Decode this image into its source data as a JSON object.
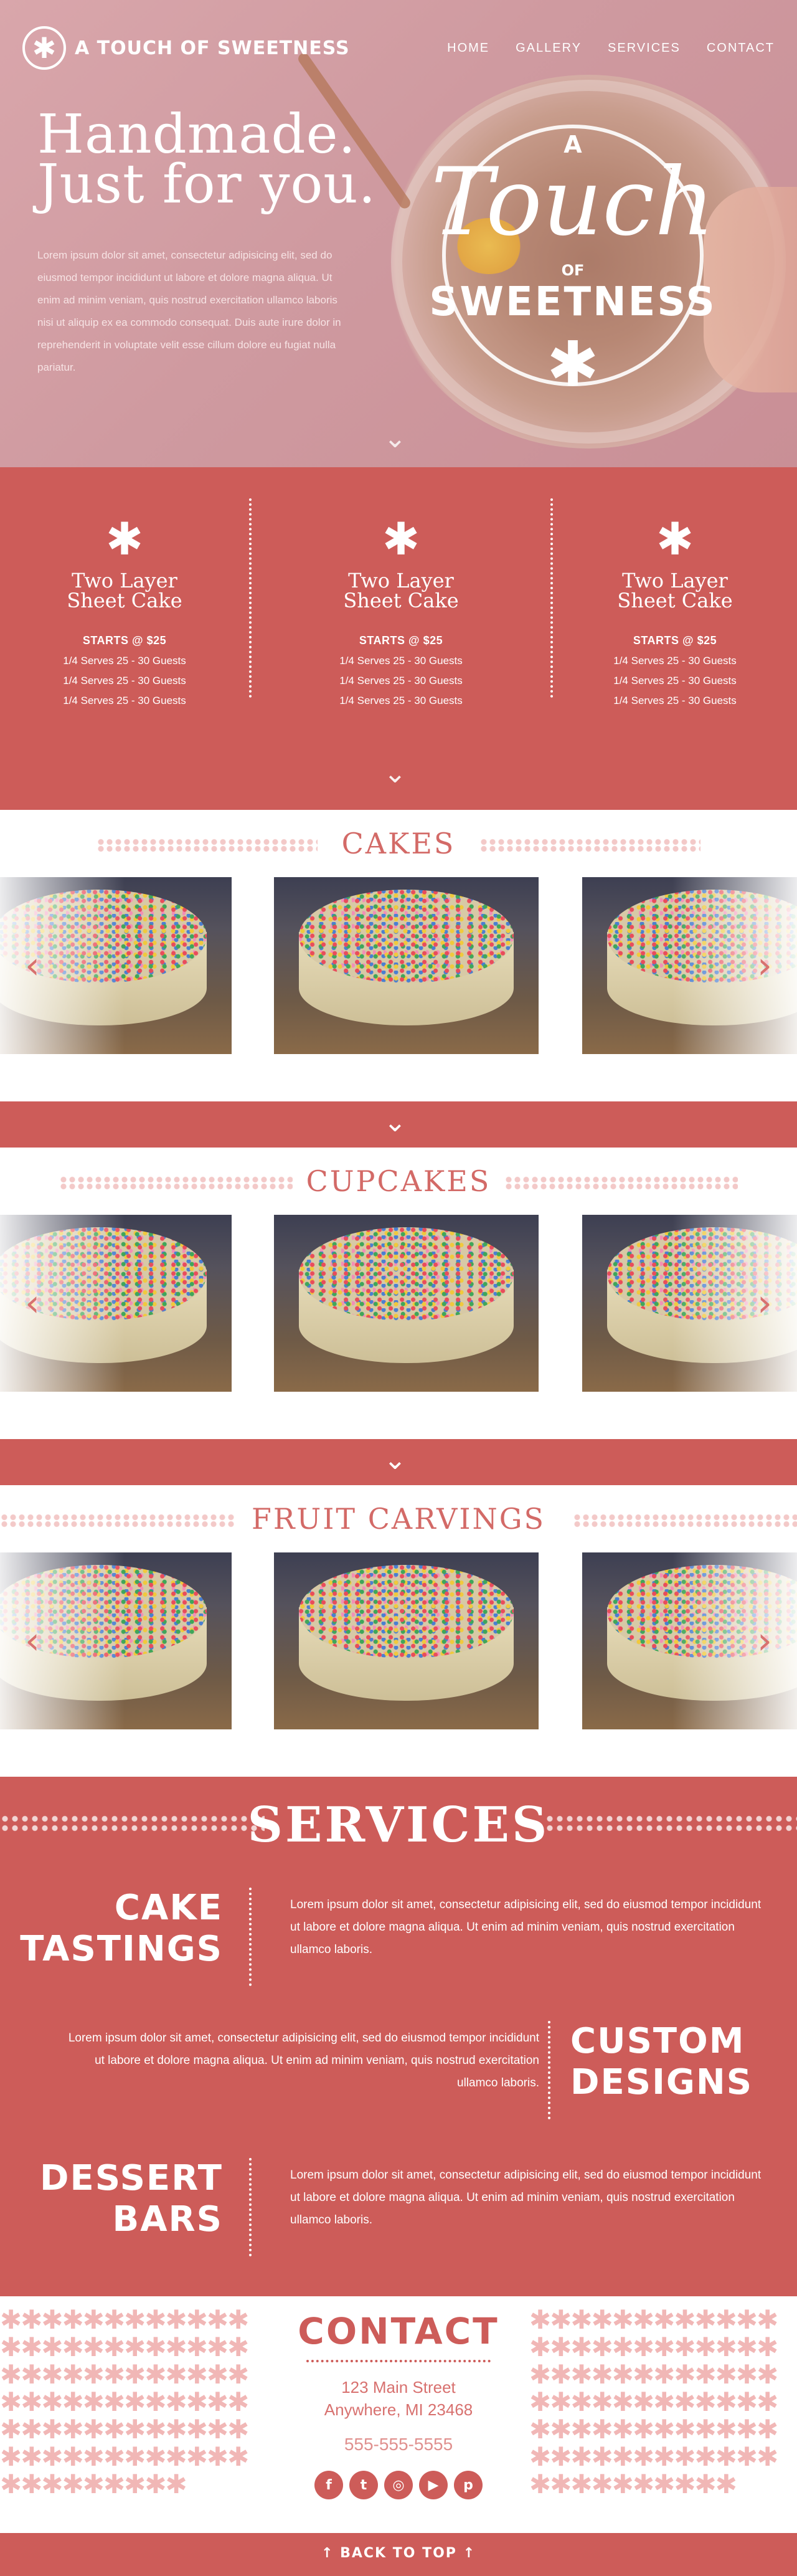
{
  "colors": {
    "accent": "#cd5c59",
    "accent_light": "#d36a67",
    "hero_pink": "#cf9aa0"
  },
  "brand": {
    "name": "A TOUCH OF SWEETNESS",
    "icon": "asterisk-logo-icon"
  },
  "nav": {
    "items": [
      "HOME",
      "GALLERY",
      "SERVICES",
      "CONTACT"
    ]
  },
  "hero": {
    "title_line1": "Handmade.",
    "title_line2": "Just for you.",
    "body": "Lorem ipsum dolor sit amet, consectetur adipisicing elit, sed do eiusmod tempor incididunt ut labore et dolore magna aliqua. Ut enim ad minim veniam, quis nostrud exercitation ullamco laboris nisi ut aliquip ex ea commodo consequat. Duis aute irure dolor in reprehenderit in voluptate velit esse cillum dolore eu fugiat nulla pariatur.",
    "logo": {
      "a": "A",
      "touch": "Touch",
      "of": "OF",
      "sweetness": "SWEETNESS"
    },
    "down_icon": "chevron-down-icon"
  },
  "pricing": {
    "plans": [
      {
        "title_line1": "Two Layer",
        "title_line2": "Sheet Cake",
        "starts": "STARTS @ $25",
        "rows": [
          "1/4 Serves   25 - 30 Guests",
          "1/4 Serves   25 - 30 Guests",
          "1/4 Serves   25 - 30 Guests"
        ]
      },
      {
        "title_line1": "Two Layer",
        "title_line2": "Sheet Cake",
        "starts": "STARTS @ $25",
        "rows": [
          "1/4 Serves   25 - 30 Guests",
          "1/4 Serves   25 - 30 Guests",
          "1/4 Serves   25 - 30 Guests"
        ]
      },
      {
        "title_line1": "Two Layer",
        "title_line2": "Sheet Cake",
        "starts": "STARTS @ $25",
        "rows": [
          "1/4 Serves   25 - 30 Guests",
          "1/4 Serves   25 - 30 Guests",
          "1/4 Serves   25 - 30 Guests"
        ]
      }
    ]
  },
  "gallery": {
    "sections": [
      {
        "title": "CAKES"
      },
      {
        "title": "CUPCAKES"
      },
      {
        "title": "FRUIT CARVINGS"
      }
    ]
  },
  "services": {
    "title": "SERVICES",
    "items": [
      {
        "line1": "CAKE",
        "line2": "TASTINGS",
        "text": "Lorem ipsum dolor sit amet, consectetur adipisicing elit, sed do eiusmod tempor incididunt ut labore et dolore magna aliqua. Ut enim ad minim veniam, quis nostrud exercitation ullamco laboris."
      },
      {
        "line1": "CUSTOM",
        "line2": "DESIGNS",
        "text": "Lorem ipsum dolor sit amet, consectetur adipisicing elit, sed do eiusmod tempor incididunt ut labore et dolore magna aliqua. Ut enim ad minim veniam, quis nostrud exercitation ullamco laboris."
      },
      {
        "line1": "DESSERT",
        "line2": "BARS",
        "text": "Lorem ipsum dolor sit amet, consectetur adipisicing elit, sed do eiusmod tempor incididunt ut labore et dolore magna aliqua. Ut enim ad minim veniam, quis nostrud exercitation ullamco laboris."
      }
    ]
  },
  "contact": {
    "title": "CONTACT",
    "address_line1": "123 Main Street",
    "address_line2": "Anywhere, MI 23468",
    "phone": "555-555-5555",
    "socials": [
      "facebook-icon",
      "twitter-icon",
      "instagram-icon",
      "youtube-icon",
      "pinterest-icon"
    ]
  },
  "footer": {
    "back_to_top": "BACK TO TOP"
  }
}
